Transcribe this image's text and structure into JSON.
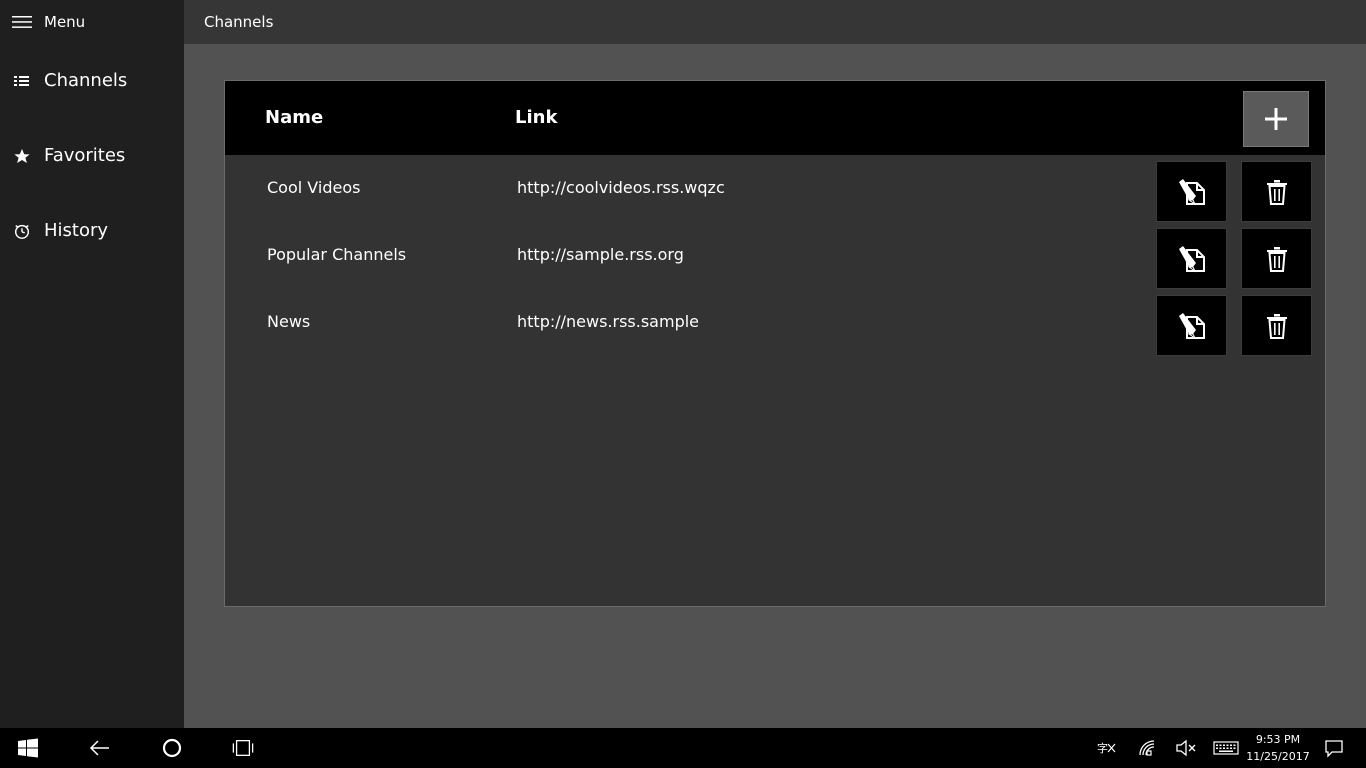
{
  "sidebar": {
    "menu_label": "Menu",
    "items": [
      {
        "label": "Channels",
        "icon": "list-icon"
      },
      {
        "label": "Favorites",
        "icon": "star-icon"
      },
      {
        "label": "History",
        "icon": "history-icon"
      }
    ]
  },
  "header": {
    "title": "Channels"
  },
  "table": {
    "columns": [
      "Name",
      "Link"
    ],
    "add_icon": "plus-icon",
    "rows": [
      {
        "name": "Cool Videos",
        "link": "http://coolvideos.rss.wqzc"
      },
      {
        "name": "Popular Channels",
        "link": "http://sample.rss.org"
      },
      {
        "name": "News",
        "link": "http://news.rss.sample"
      }
    ],
    "row_actions": [
      "edit-icon",
      "trash-icon"
    ]
  },
  "taskbar": {
    "time": "9:53 PM",
    "date": "11/25/2017",
    "icons": [
      "windows-start-icon",
      "back-icon",
      "cortana-icon",
      "task-view-icon",
      "input-indicator-icon",
      "network-icon",
      "volume-muted-icon",
      "keyboard-icon",
      "action-center-icon"
    ]
  },
  "colors": {
    "sidebar_bg": "#1f1f1f",
    "header_bg": "#363636",
    "content_bg": "#525252",
    "panel_bg": "#333333",
    "table_head_bg": "#000000",
    "accent_button": "#5a5a5a"
  }
}
